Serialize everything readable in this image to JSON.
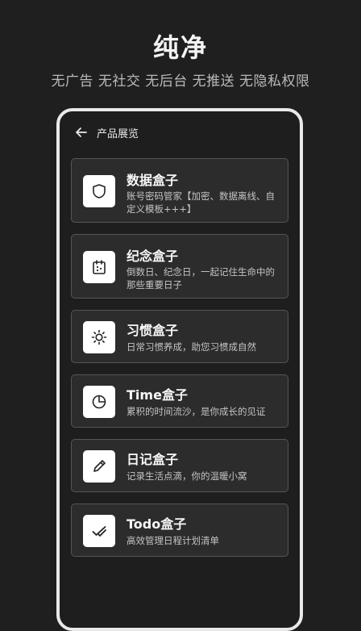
{
  "header": {
    "title": "纯净",
    "subtitle": "无广告 无社交 无后台 无推送 无隐私权限"
  },
  "phone": {
    "topbar": {
      "back_icon": "arrow-left-icon",
      "title": "产品展览"
    },
    "products": [
      {
        "title": "数据盒子",
        "desc": "账号密码管家【加密、数据离线、自定义模板+++】",
        "icon": "shield-icon"
      },
      {
        "title": "纪念盒子",
        "desc": "倒数日、纪念日，一起记住生命中的那些重要日子",
        "icon": "calendar-icon"
      },
      {
        "title": "习惯盒子",
        "desc": "日常习惯养成，助您习惯成自然",
        "icon": "sun-icon"
      },
      {
        "title": "Time盒子",
        "desc": "累积的时间流沙，是你成长的见证",
        "icon": "pie-chart-icon"
      },
      {
        "title": "日记盒子",
        "desc": "记录生活点滴，你的温暖小窝",
        "icon": "pencil-icon"
      },
      {
        "title": "Todo盒子",
        "desc": "高效管理日程计划清单",
        "icon": "check-icon"
      }
    ]
  },
  "colors": {
    "background": "#1f1f20",
    "card_background": "#2c2c2d",
    "card_border": "#555557",
    "icon_background": "#ffffff",
    "frame": "#e9e9e9"
  }
}
